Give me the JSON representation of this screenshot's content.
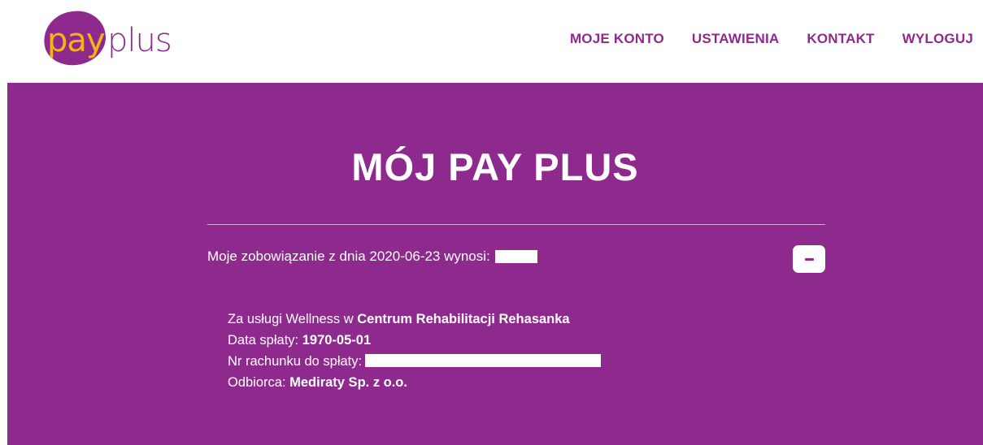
{
  "brand": {
    "logo_pay": "pay",
    "logo_plus": "plus"
  },
  "nav": {
    "items": [
      {
        "label": "MOJE KONTO"
      },
      {
        "label": "USTAWIENIA"
      },
      {
        "label": "KONTAKT"
      },
      {
        "label": "WYLOGUJ"
      }
    ]
  },
  "main": {
    "title": "MÓJ PAY PLUS",
    "summary_text": "Moje zobowiązanie z dnia 2020-06-23 wynosi:",
    "collapse_label": "-",
    "details": {
      "service_prefix": "Za usługi Wellness w ",
      "service_place": "Centrum Rehabilitacji Rehasanka",
      "due_label": "Data spłaty: ",
      "due_date": "1970-05-01",
      "account_label": "Nr rachunku do spłaty:",
      "recipient_label": "Odbiorca: ",
      "recipient": "Mediraty Sp. z o.o."
    }
  },
  "colors": {
    "brand_purple": "#8e2a8d",
    "logo_yellow": "#f6b21a",
    "logo_pink": "#f48cc8"
  }
}
